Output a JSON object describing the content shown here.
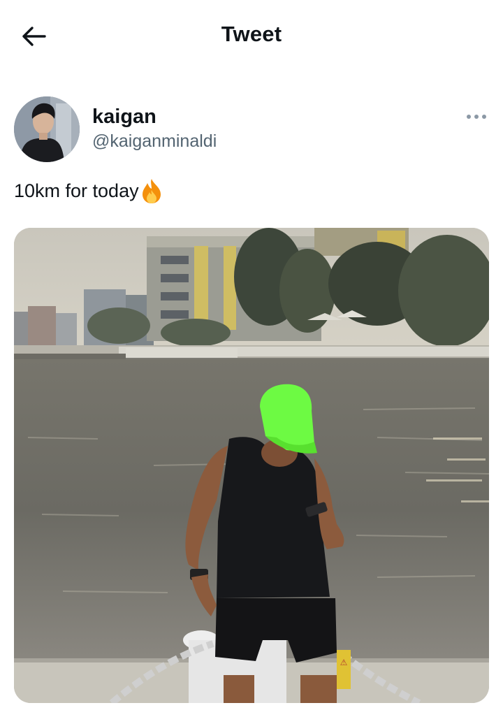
{
  "header": {
    "title": "Tweet",
    "back_icon": "arrow-left-icon"
  },
  "tweet": {
    "author": {
      "display_name": "kaigan",
      "handle": "@kaiganminaldi",
      "avatar_icon": "avatar"
    },
    "more_icon": "more-horizontal-icon",
    "text": "10km for today",
    "emoji_icon": "fire-icon",
    "media": {
      "kind": "photo",
      "sign_text": "⚠"
    }
  }
}
